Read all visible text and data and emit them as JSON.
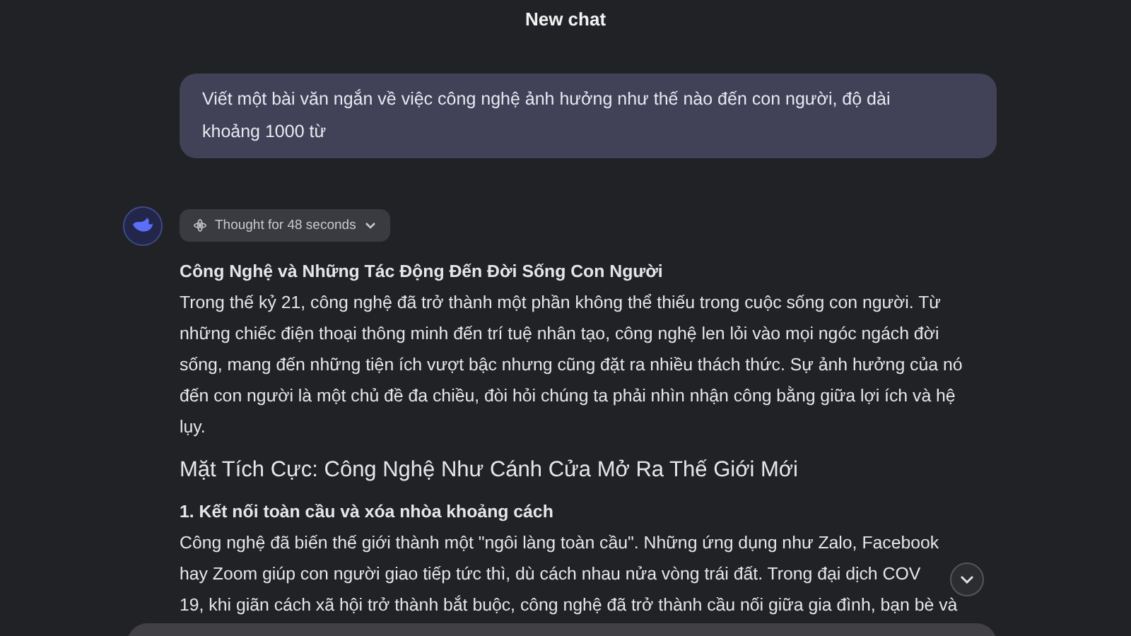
{
  "header": {
    "title": "New chat"
  },
  "user_message": {
    "lines": [
      "Viết một bài văn ngắn về việc công nghệ ảnh hưởng như thế nào đến con người, độ dài",
      "khoảng 1000 từ"
    ]
  },
  "thought": {
    "label": "Thought for 48 seconds",
    "expanded": false
  },
  "answer": [
    {
      "kind": "title",
      "lines": [
        "Công Nghệ và Những Tác Động Đến Đời Sống Con Người"
      ]
    },
    {
      "kind": "paragraph",
      "lines": [
        "Trong thế kỷ 21, công nghệ đã trở thành một phần không thể thiếu trong cuộc sống con người. Từ",
        "những chiếc điện thoại thông minh đến trí tuệ nhân tạo, công nghệ len lỏi vào mọi ngóc ngách đời",
        "sống, mang đến những tiện ích vượt bậc nhưng cũng đặt ra nhiều thách thức. Sự ảnh hưởng của nó",
        "đến con người là một chủ đề đa chiều, đòi hỏi chúng ta phải nhìn nhận công bằng giữa lợi ích và hệ",
        "lụy."
      ]
    },
    {
      "kind": "section",
      "lines": [
        "Mặt Tích Cực: Công Nghệ Như Cánh Cửa Mở Ra Thế Giới Mới"
      ]
    },
    {
      "kind": "title",
      "lines": [
        "1. Kết nối toàn cầu và xóa nhòa khoảng cách"
      ]
    },
    {
      "kind": "paragraph",
      "lines": [
        "Công nghệ đã biến thế giới thành một \"ngôi làng toàn cầu\". Những ứng dụng như Zalo, Facebook",
        "hay Zoom giúp con người giao tiếp tức thì, dù cách nhau nửa vòng trái đất. Trong đại dịch COV",
        "19, khi giãn cách xã hội trở thành bắt buộc, công nghệ đã trở thành cầu nối giữa gia đình, bạn bè và"
      ]
    }
  ]
}
